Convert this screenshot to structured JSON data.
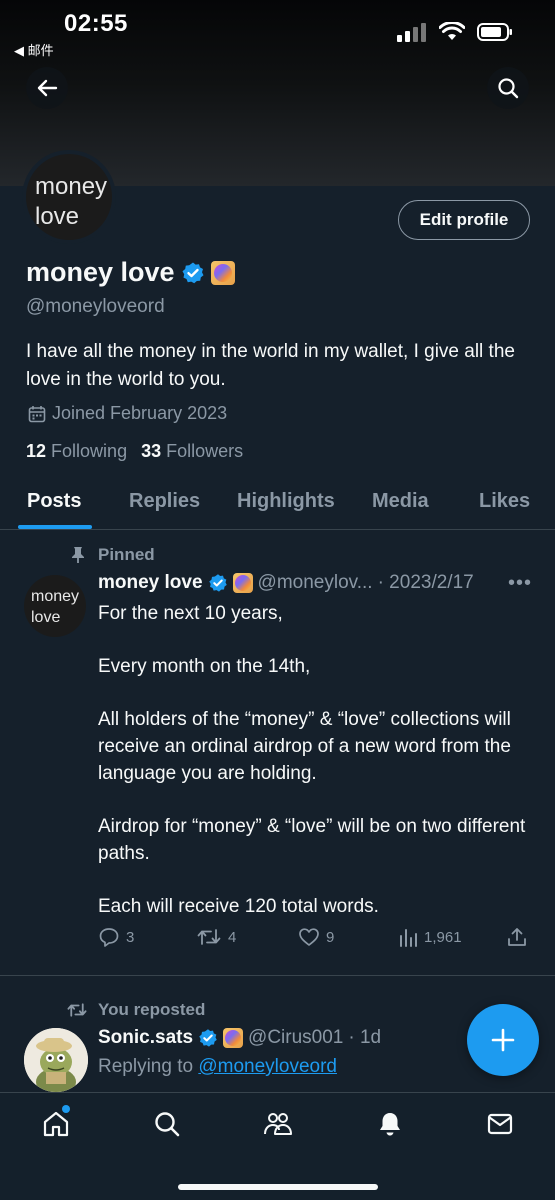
{
  "status_bar": {
    "time": "02:55",
    "back_app": "◀ 邮件"
  },
  "profile": {
    "avatar_text_line1": "money",
    "avatar_text_line2": "love",
    "name": "money love",
    "handle": "@moneyloveord",
    "bio": "I have all the money in the world in my wallet, I give all the love in the world to you.",
    "joined": "Joined February 2023",
    "following_count": "12",
    "following_label": "Following",
    "followers_count": "33",
    "followers_label": "Followers",
    "edit_button": "Edit profile"
  },
  "tabs": [
    {
      "label": "Posts",
      "active": true
    },
    {
      "label": "Replies",
      "active": false
    },
    {
      "label": "Highlights",
      "active": false
    },
    {
      "label": "Media",
      "active": false
    },
    {
      "label": "Likes",
      "active": false
    }
  ],
  "pinned_post": {
    "pinned_label": "Pinned",
    "author_name": "money love",
    "author_handle": "@moneylov...",
    "date": "· 2023/2/17",
    "more": "•••",
    "paragraphs": [
      "For the next 10 years,",
      "Every month on the 14th,",
      "All holders of the “money” & “love” collections will receive an ordinal airdrop of a new word from the language you are holding.",
      "Airdrop for “money” & “love” will be on two different paths.",
      "Each will receive 120 total words."
    ],
    "replies": "3",
    "reposts": "4",
    "likes": "9",
    "views": "1,961"
  },
  "repost": {
    "label": "You reposted",
    "author_name": "Sonic.sats",
    "author_handle": "@Cirus001",
    "time": "· 1d",
    "replying_prefix": "Replying to",
    "replying_handle": "@moneyloveord"
  },
  "colors": {
    "accent": "#1d9bf0",
    "background": "#15202b",
    "muted": "#8b98a5",
    "border": "#38444d"
  },
  "icons": [
    "back-arrow-icon",
    "search-icon",
    "verified-icon",
    "nft-badge-icon",
    "calendar-icon",
    "pin-icon",
    "reply-icon",
    "repost-icon",
    "like-icon",
    "views-icon",
    "share-icon",
    "compose-icon",
    "home-icon",
    "explore-icon",
    "communities-icon",
    "notifications-icon",
    "messages-icon"
  ]
}
